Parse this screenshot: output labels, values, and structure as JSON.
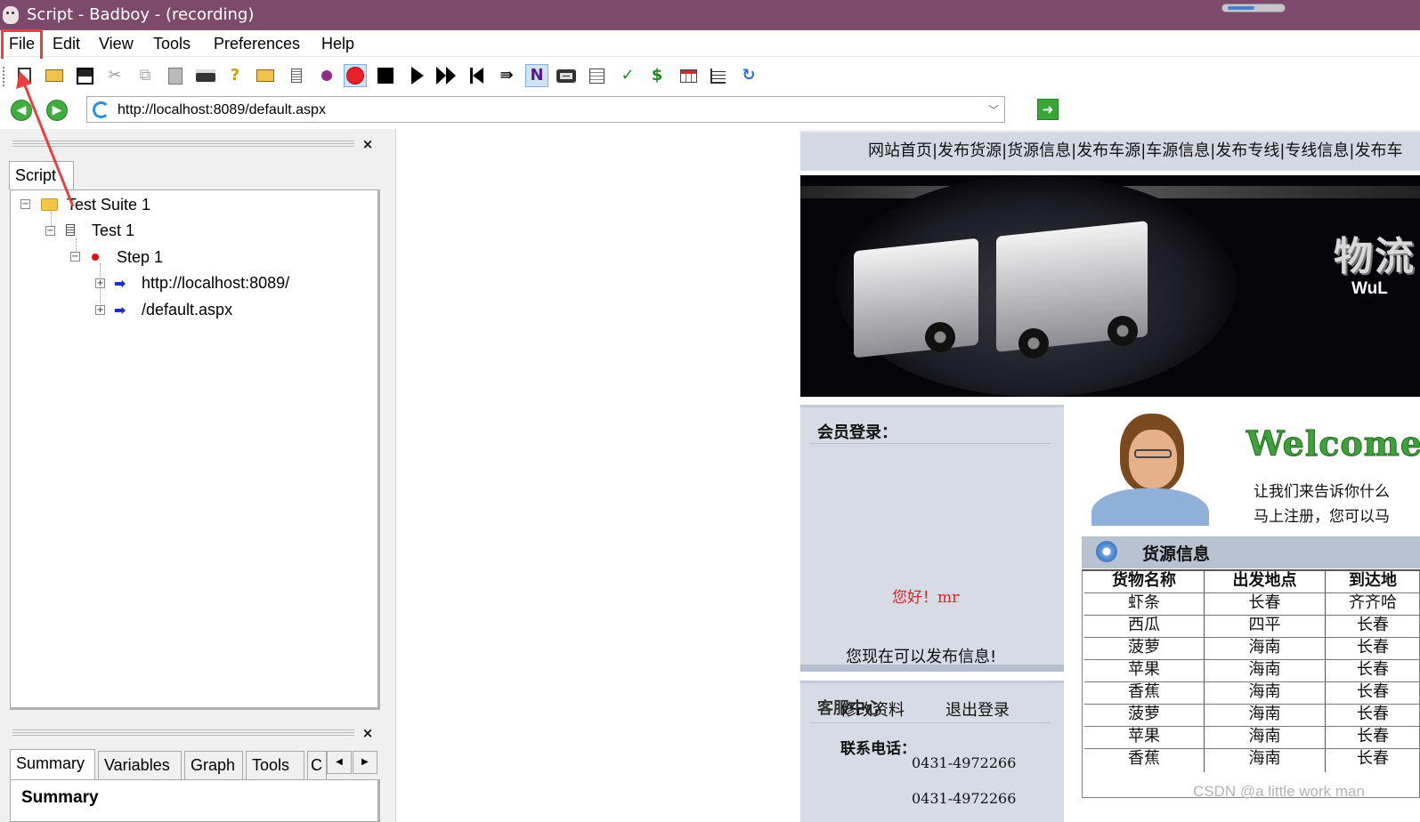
{
  "window": {
    "title": "Script - Badboy - (recording)"
  },
  "menu": [
    "File",
    "Edit",
    "View",
    "Tools",
    "Preferences",
    "Help"
  ],
  "toolbar": {
    "icons": [
      "new-script-icon",
      "open-icon",
      "save-icon",
      "cut-icon",
      "copy-icon",
      "paste-icon",
      "print-icon",
      "help-icon",
      "add-suite-icon",
      "add-test-icon",
      "add-step-icon",
      "record-icon",
      "stop-icon",
      "play-icon",
      "play-all-icon",
      "rewind-icon",
      "step-icon",
      "navigation-mode-icon",
      "screenshot-icon",
      "report-icon",
      "assertion-icon",
      "variable-icon",
      "table-icon",
      "timer-icon",
      "refresh-icon"
    ],
    "check_glyph": "✓",
    "dollar_glyph": "$",
    "n_glyph": "N"
  },
  "address": {
    "url": "http://localhost:8089/default.aspx"
  },
  "script_panel": {
    "tab": "Script",
    "tree": [
      {
        "label": "Test Suite 1",
        "level": 0
      },
      {
        "label": "Test 1",
        "level": 1
      },
      {
        "label": "Step 1",
        "level": 2
      },
      {
        "label": "http://localhost:8089/",
        "level": 3
      },
      {
        "label": "/default.aspx",
        "level": 3
      }
    ]
  },
  "bottom_panel": {
    "tabs": [
      "Summary",
      "Variables",
      "Graph",
      "Tools",
      "C"
    ],
    "heading": "Summary"
  },
  "page": {
    "nav": "网站首页|发布货源|货源信息|发布车源|车源信息|发布专线|专线信息|发布车",
    "banner": {
      "big": "物流",
      "small": "WuL"
    },
    "login": {
      "title": "会员登录：",
      "greeting": "您好！mr",
      "hint": "您现在可以发布信息!"
    },
    "service": {
      "overlay_a": "客服中心",
      "overlay_b": "修改资料",
      "logout": "退出登录",
      "phone_label": "联系电话：",
      "phone1": "0431-4972266",
      "phone2": "0431-4972266"
    },
    "welcome": {
      "title": "Welcome",
      "line1": "让我们来告诉你什么",
      "line2": "马上注册，您可以马"
    },
    "goods": {
      "title": "货源信息",
      "headers": [
        "货物名称",
        "出发地点",
        "到达地"
      ],
      "rows": [
        [
          "虾条",
          "长春",
          "齐齐哈"
        ],
        [
          "西瓜",
          "四平",
          "长春"
        ],
        [
          "菠萝",
          "海南",
          "长春"
        ],
        [
          "苹果",
          "海南",
          "长春"
        ],
        [
          "香蕉",
          "海南",
          "长春"
        ],
        [
          "菠萝",
          "海南",
          "长春"
        ],
        [
          "苹果",
          "海南",
          "长春"
        ],
        [
          "香蕉",
          "海南",
          "长春"
        ]
      ]
    }
  },
  "watermark": "CSDN @a little work man",
  "colors": {
    "titlebar": "#7e4a6b",
    "highlight": "#e84040",
    "record": "#e8202a",
    "welcome": "#3ea13a"
  }
}
